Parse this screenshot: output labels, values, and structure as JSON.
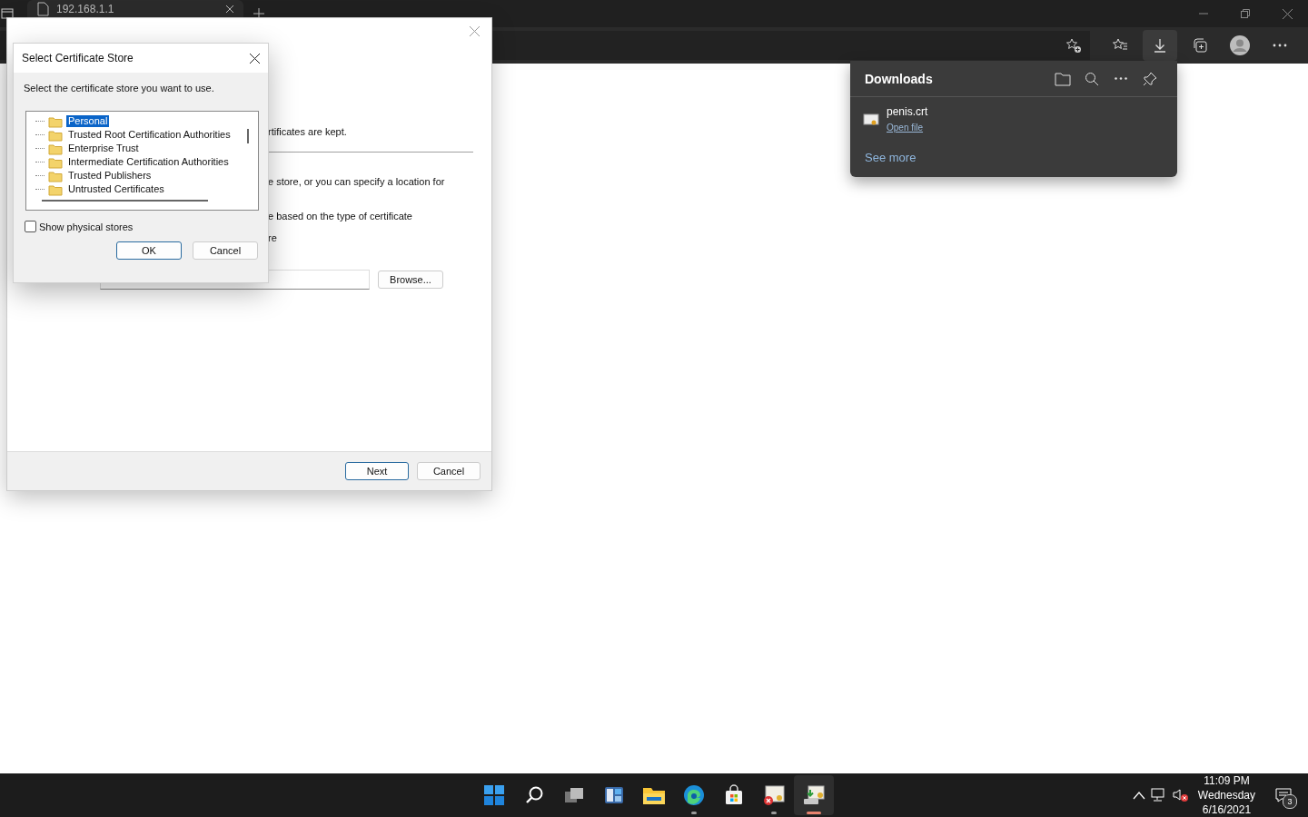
{
  "browser": {
    "tab": {
      "title": "192.168.1.1"
    },
    "toolbar_buttons": [
      {
        "selected": false
      },
      {
        "selected": true
      },
      {
        "selected": false
      },
      {
        "selected": false
      },
      {
        "selected": false
      }
    ]
  },
  "downloads": {
    "title": "Downloads",
    "items": [
      {
        "name": "penis.crt",
        "action": "Open file"
      }
    ],
    "see_more": "See more"
  },
  "wizard": {
    "texts": [
      "rtificates are kept.",
      "e store, or you can specify a location for",
      "e based on the type of certificate",
      "re"
    ],
    "browse": "Browse...",
    "buttons": [
      {
        "label": "Next",
        "default": true
      },
      {
        "label": "Cancel",
        "default": false
      }
    ]
  },
  "dialog": {
    "title": "Select Certificate Store",
    "instruction": "Select the certificate store you want to use.",
    "stores": [
      {
        "label": "Personal",
        "selected": true
      },
      {
        "label": "Trusted Root Certification Authorities",
        "selected": false
      },
      {
        "label": "Enterprise Trust",
        "selected": false
      },
      {
        "label": "Intermediate Certification Authorities",
        "selected": false
      },
      {
        "label": "Trusted Publishers",
        "selected": false
      },
      {
        "label": "Untrusted Certificates",
        "selected": false
      }
    ],
    "show_physical": {
      "label": "Show physical stores",
      "checked": false
    },
    "buttons": [
      {
        "label": "OK",
        "default": true
      },
      {
        "label": "Cancel",
        "default": false
      }
    ]
  },
  "taskbar": {
    "apps": [
      {
        "running": false,
        "selected": false
      },
      {
        "running": false,
        "selected": false
      },
      {
        "running": false,
        "selected": false
      },
      {
        "running": false,
        "selected": false
      },
      {
        "running": false,
        "selected": false
      },
      {
        "running": true,
        "selected": false
      },
      {
        "running": false,
        "selected": false
      },
      {
        "running": true,
        "selected": false
      },
      {
        "running": true,
        "selected": true
      }
    ],
    "time": "11:09 PM",
    "day": "Wednesday",
    "date": "6/16/2021",
    "notifications": "3"
  }
}
